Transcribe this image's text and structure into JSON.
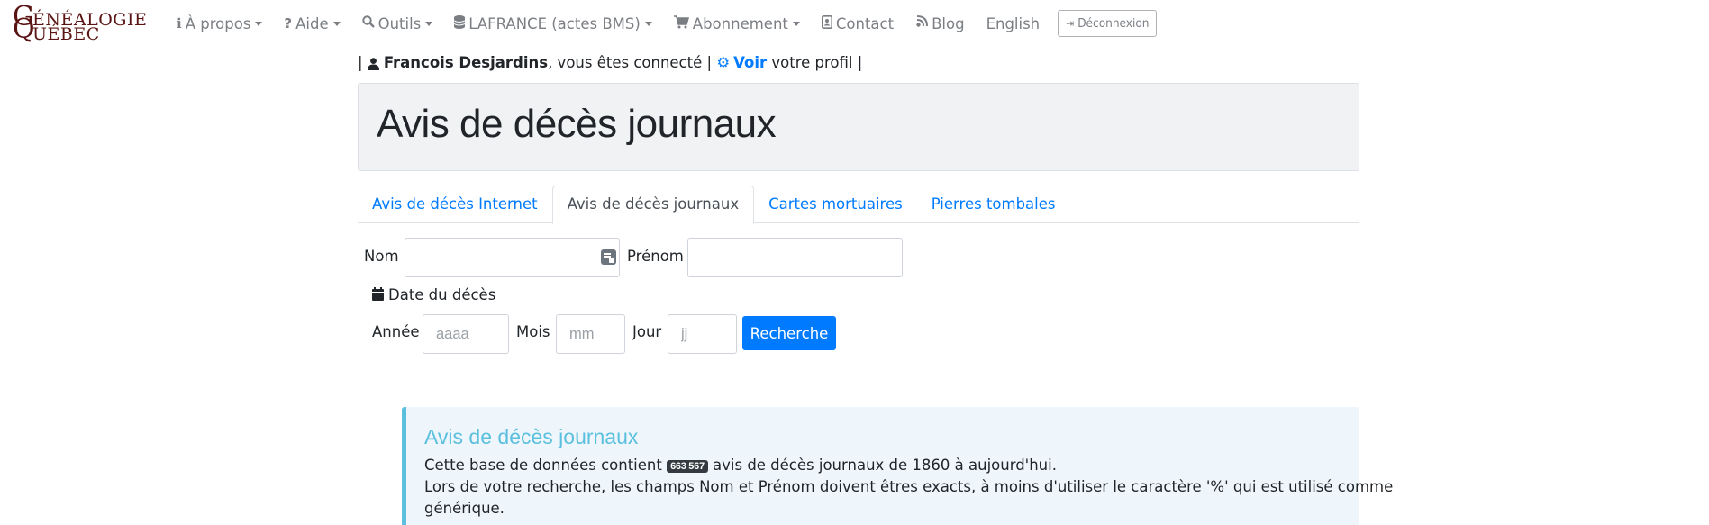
{
  "logo": {
    "big1": "G",
    "small1": "ÉNÉALOGIE",
    "big2": "Q",
    "small2": "UÉBEC"
  },
  "nav": {
    "items": [
      {
        "icon": "info-icon",
        "label": "À propos",
        "dropdown": true
      },
      {
        "icon": "question-icon",
        "label": "Aide",
        "dropdown": true
      },
      {
        "icon": "search-icon",
        "label": "Outils",
        "dropdown": true
      },
      {
        "icon": "database-icon",
        "label": "LAFRANCE (actes BMS)",
        "dropdown": true
      },
      {
        "icon": "cart-icon",
        "label": "Abonnement",
        "dropdown": true
      },
      {
        "icon": "contact-icon",
        "label": "Contact",
        "dropdown": false
      },
      {
        "icon": "blog-icon",
        "label": "Blog",
        "dropdown": false
      },
      {
        "icon": "",
        "label": "English",
        "dropdown": false
      }
    ],
    "logout_label": "Déconnexion"
  },
  "user": {
    "sep_left": "|",
    "name": "Francois Desjardins",
    "connected_text": ", vous êtes connecté |",
    "profile_link": "Voir",
    "profile_text": "votre profil |"
  },
  "page_title": "Avis de décès journaux",
  "tabs": [
    {
      "label": "Avis de décès Internet",
      "active": false
    },
    {
      "label": "Avis de décès journaux",
      "active": true
    },
    {
      "label": "Cartes mortuaires",
      "active": false
    },
    {
      "label": "Pierres tombales",
      "active": false
    }
  ],
  "form": {
    "nom_label": "Nom",
    "nom_value": "",
    "prenom_label": "Prénom",
    "prenom_value": "",
    "date_label": "Date du décès",
    "annee_label": "Année",
    "annee_placeholder": "aaaa",
    "mois_label": "Mois",
    "mois_placeholder": "mm",
    "jour_label": "Jour",
    "jour_placeholder": "jj",
    "search_button": "Recherche"
  },
  "info": {
    "title": "Avis de décès journaux",
    "line1_prefix": "Cette base de données contient",
    "count": "663 567",
    "line1_suffix": "avis de décès journaux de 1860 à aujourd'hui.",
    "line2": "Lors de votre recherche, les champs Nom et Prénom doivent êtres exacts, à moins d'utiliser le caractère '%' qui est utilisé comme",
    "line3": "générique."
  },
  "colors": {
    "link": "#007bff",
    "logo": "#5a1414",
    "info_accent": "#5bc0de"
  }
}
